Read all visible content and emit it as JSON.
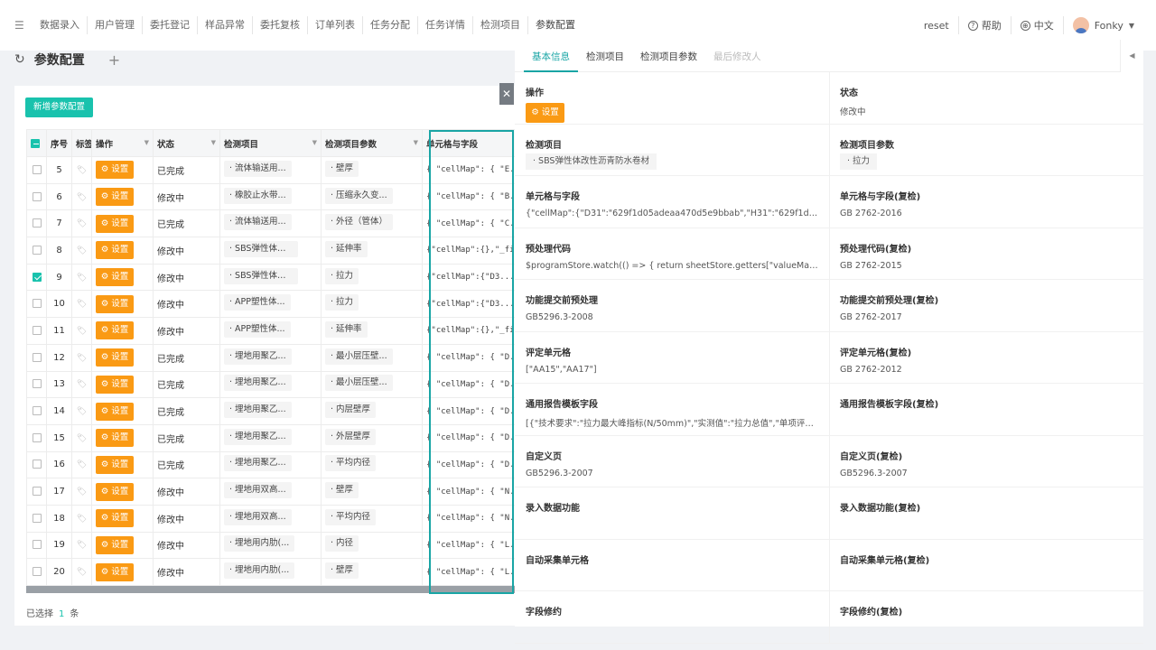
{
  "nav": {
    "tabs": [
      "数据录入",
      "用户管理",
      "委托登记",
      "样品异常",
      "委托复核",
      "订单列表",
      "任务分配",
      "任务详情",
      "检测项目",
      "参数配置"
    ],
    "reset": "reset",
    "help": "帮助",
    "lang": "中文",
    "user": "Fonky"
  },
  "page": {
    "title": "参数配置",
    "new_button": "新增参数配置"
  },
  "table": {
    "headers": {
      "seq": "序号",
      "tag": "标签",
      "action": "操作",
      "status": "状态",
      "item": "检测项目",
      "param": "检测项目参数",
      "cell": "单元格与字段"
    },
    "action_label": "设置",
    "rows": [
      {
        "seq": "5",
        "status": "已完成",
        "item": "· 流体输送用...",
        "param": "· 壁厚",
        "cell": "{ \"cellMap\": { \"E...",
        "checked": false
      },
      {
        "seq": "6",
        "status": "修改中",
        "item": "· 橡胶止水带...",
        "param": "· 压缩永久变...",
        "cell": "{ \"cellMap\": { \"B...",
        "checked": false
      },
      {
        "seq": "7",
        "status": "已完成",
        "item": "· 流体输送用...",
        "param": "· 外径（管体）",
        "cell": "{ \"cellMap\": { \"C...",
        "checked": false
      },
      {
        "seq": "8",
        "status": "修改中",
        "item": "· SBS弹性体改...",
        "param": "· 延伸率",
        "cell": "{\"cellMap\":{},\"_fi...",
        "checked": false
      },
      {
        "seq": "9",
        "status": "修改中",
        "item": "· SBS弹性体改...",
        "param": "· 拉力",
        "cell": "{\"cellMap\":{\"D3...",
        "checked": true
      },
      {
        "seq": "10",
        "status": "修改中",
        "item": "· APP塑性体...",
        "param": "· 拉力",
        "cell": "{\"cellMap\":{\"D3...",
        "checked": false
      },
      {
        "seq": "11",
        "status": "修改中",
        "item": "· APP塑性体...",
        "param": "· 延伸率",
        "cell": "{\"cellMap\":{},\"_fi...",
        "checked": false
      },
      {
        "seq": "12",
        "status": "已完成",
        "item": "· 埋地用聚乙...",
        "param": "· 最小层压壁...",
        "cell": "{ \"cellMap\": { \"D...",
        "checked": false
      },
      {
        "seq": "13",
        "status": "已完成",
        "item": "· 埋地用聚乙...",
        "param": "· 最小层压壁...",
        "cell": "{ \"cellMap\": { \"D...",
        "checked": false
      },
      {
        "seq": "14",
        "status": "已完成",
        "item": "· 埋地用聚乙...",
        "param": "· 内层壁厚",
        "cell": "{ \"cellMap\": { \"D...",
        "checked": false
      },
      {
        "seq": "15",
        "status": "已完成",
        "item": "· 埋地用聚乙...",
        "param": "· 外层壁厚",
        "cell": "{ \"cellMap\": { \"D...",
        "checked": false
      },
      {
        "seq": "16",
        "status": "已完成",
        "item": "· 埋地用聚乙...",
        "param": "· 平均内径",
        "cell": "{ \"cellMap\": { \"D...",
        "checked": false
      },
      {
        "seq": "17",
        "status": "修改中",
        "item": "· 埋地用双高...",
        "param": "· 壁厚",
        "cell": "{ \"cellMap\": { \"N...",
        "checked": false
      },
      {
        "seq": "18",
        "status": "修改中",
        "item": "· 埋地用双高...",
        "param": "· 平均内径",
        "cell": "{ \"cellMap\": { \"N...",
        "checked": false
      },
      {
        "seq": "19",
        "status": "修改中",
        "item": "· 埋地用内肋(...",
        "param": "· 内径",
        "cell": "{ \"cellMap\": { \"L...",
        "checked": false
      },
      {
        "seq": "20",
        "status": "修改中",
        "item": "· 埋地用内肋(...",
        "param": "· 壁厚",
        "cell": "{ \"cellMap\": { \"L...",
        "checked": false
      }
    ]
  },
  "footer": {
    "prefix": "已选择",
    "count": "1",
    "suffix": "条"
  },
  "panel": {
    "tabs": [
      "基本信息",
      "检测项目",
      "检测项目参数",
      "最后修改人"
    ],
    "fields": [
      {
        "l_label": "操作",
        "l_value": "设置",
        "r_label": "状态",
        "r_value": "修改中"
      },
      {
        "l_label": "检测项目",
        "l_value": "· SBS弹性体改性沥青防水卷材",
        "r_label": "检测项目参数",
        "r_value": "· 拉力"
      },
      {
        "l_label": "单元格与字段",
        "l_value": "{\"cellMap\":{\"D31\":\"629f1d05adeaa470d5e9bbab\",\"H31\":\"629f1d05a...",
        "r_label": "单元格与字段(复检)",
        "r_value": "GB 2762-2016"
      },
      {
        "l_label": "预处理代码",
        "l_value": "$programStore.watch(() => { return sheetStore.getters[\"valueMap\"] }...",
        "r_label": "预处理代码(复检)",
        "r_value": "GB 2762-2015"
      },
      {
        "l_label": "功能提交前预处理",
        "l_value": "GB5296.3-2008",
        "r_label": "功能提交前预处理(复检)",
        "r_value": "GB 2762-2017"
      },
      {
        "l_label": "评定单元格",
        "l_value": "[\"AA15\",\"AA17\"]",
        "r_label": "评定单元格(复检)",
        "r_value": "GB 2762-2012"
      },
      {
        "l_label": "通用报告模板字段",
        "l_value": "[{\"技术要求\":\"拉力最大峰指标(N/50mm)\",\"实测值\":\"拉力总值\",\"单项评定...",
        "r_label": "通用报告模板字段(复检)",
        "r_value": ""
      },
      {
        "l_label": "自定义页",
        "l_value": "GB5296.3-2007",
        "r_label": "自定义页(复检)",
        "r_value": "GB5296.3-2007"
      },
      {
        "l_label": "录入数据功能",
        "l_value": "",
        "r_label": "录入数据功能(复检)",
        "r_value": ""
      },
      {
        "l_label": "自动采集单元格",
        "l_value": "",
        "r_label": "自动采集单元格(复检)",
        "r_value": ""
      },
      {
        "l_label": "字段修约",
        "l_value": "",
        "r_label": "字段修约(复检)",
        "r_value": ""
      }
    ]
  },
  "colors": {
    "accent": "#19c2ad",
    "orange": "#fa9a14",
    "highlight": "#19a5a5"
  }
}
